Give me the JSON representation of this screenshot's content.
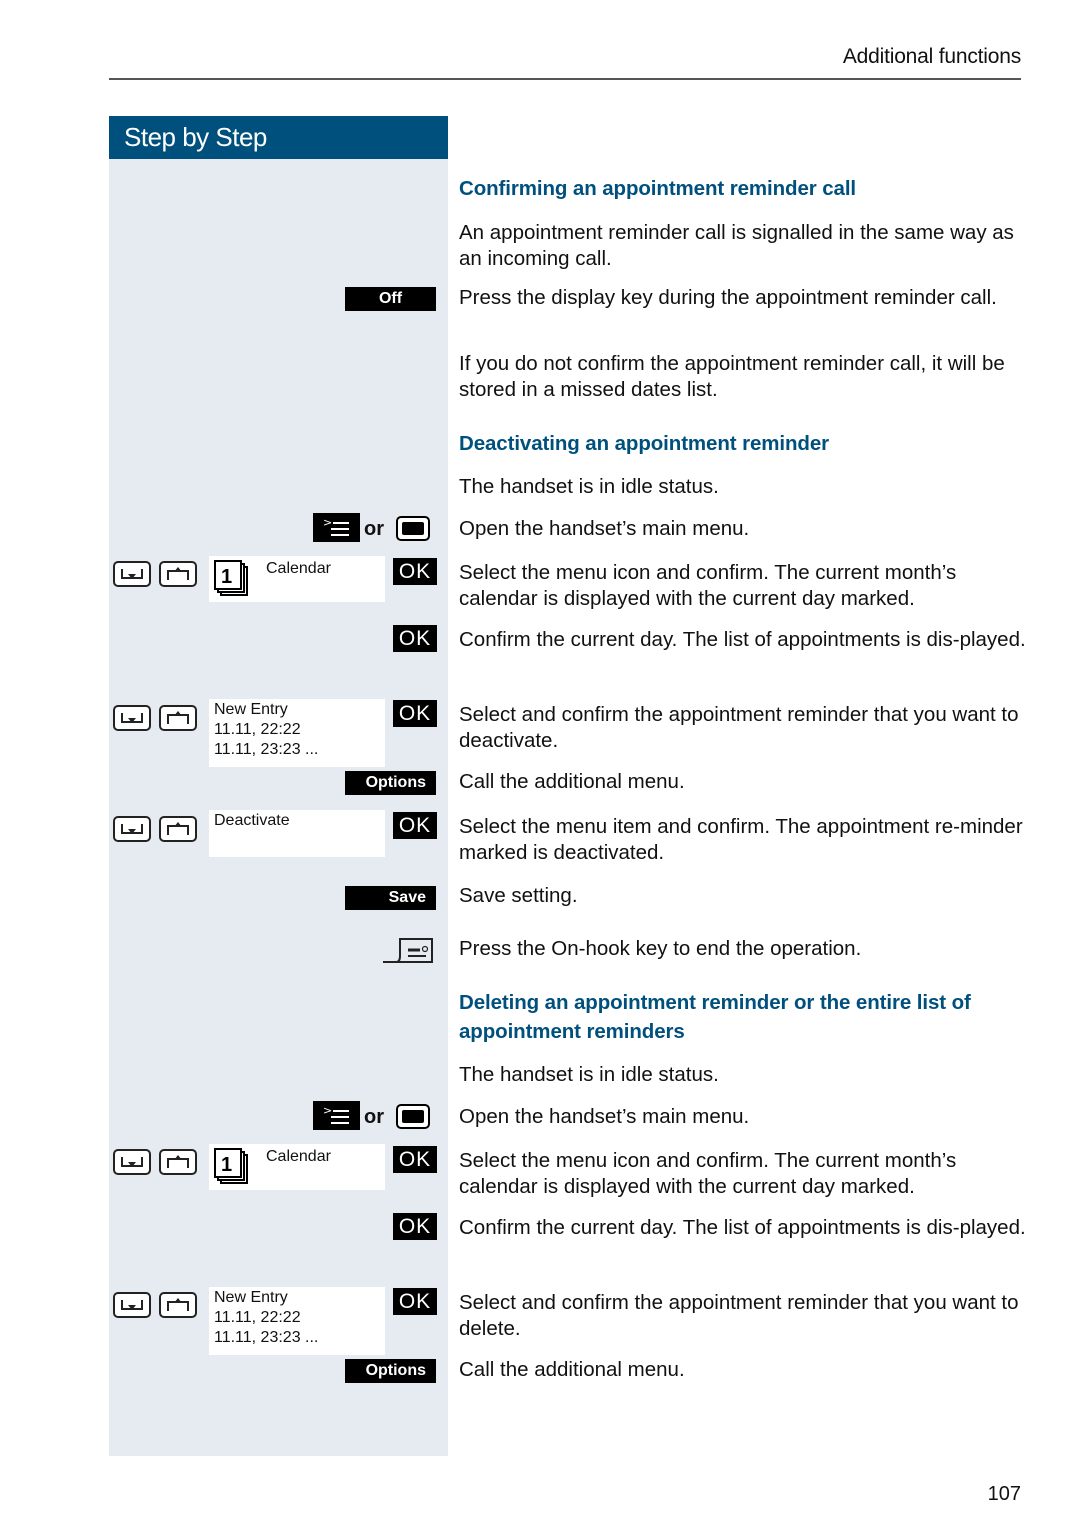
{
  "page": {
    "running_head": "Additional functions",
    "page_number": "107",
    "sidebar_title": "Step by Step"
  },
  "colors": {
    "accent": "#00507e",
    "sidebar_bg": "#e6ebf1"
  },
  "icons": {
    "or_label": "or",
    "ok_label": "OK"
  },
  "softkeys": {
    "off": "Off",
    "options": "Options",
    "save": "Save"
  },
  "screens": {
    "calendar": {
      "icon": "1",
      "label": "Calendar"
    },
    "entries": [
      "New Entry",
      "11.11, 22:22",
      "11.11, 23:23 ..."
    ],
    "deactivate": "Deactivate"
  },
  "sections": [
    {
      "heading": "Confirming an appointment reminder call",
      "paragraphs": [
        "An appointment reminder call is signalled in the same way as an incoming call.",
        "Press the display key during the appointment reminder call.",
        "If you do not confirm the appointment reminder call, it will be stored in a missed dates list."
      ]
    },
    {
      "heading": "Deactivating an appointment reminder",
      "paragraphs": [
        "The handset is in idle status.",
        "Open the handset’s main menu.",
        "Select the menu icon and confirm. The current month’s calendar is displayed with the current day marked.",
        "Confirm the current day. The list of appointments is dis-played.",
        "Select and confirm the appointment reminder that you want to deactivate.",
        "Call the additional menu.",
        "Select the menu item and confirm. The appointment re-minder marked is deactivated.",
        "Save setting.",
        "Press the On-hook key to end the operation."
      ]
    },
    {
      "heading": "Deleting an appointment reminder or the entire list of appointment reminders",
      "paragraphs": [
        "The handset is in idle status.",
        "Open the handset’s main menu.",
        "Select the menu icon and confirm. The current month’s calendar is displayed with the current day marked.",
        "Confirm the current day. The list of appointments is dis-played.",
        "Select and confirm the appointment reminder that you want to delete.",
        "Call the additional menu."
      ]
    }
  ]
}
